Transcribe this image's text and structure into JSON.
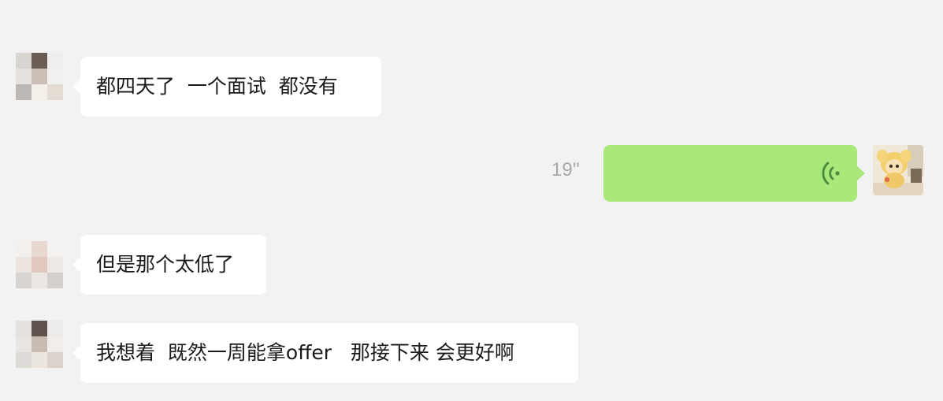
{
  "messages": [
    {
      "id": "m1",
      "sender": "contact",
      "type": "text",
      "text": "都四天了  一个面试  都没有"
    },
    {
      "id": "m2",
      "sender": "me",
      "type": "voice",
      "duration": "19''"
    },
    {
      "id": "m3",
      "sender": "contact",
      "type": "text",
      "text": "但是那个太低了"
    },
    {
      "id": "m4",
      "sender": "contact",
      "type": "text",
      "text": "我想着  既然一周能拿offer   那接下来 会更好啊"
    }
  ],
  "icons": {
    "contact_avatar": "blurred-avatar",
    "my_avatar": "cartoon-avatar",
    "voice": "voice-wave-icon"
  },
  "colors": {
    "background": "#f2f2f2",
    "incoming_bubble": "#ffffff",
    "outgoing_bubble": "#a9e97a",
    "voice_icon": "#4b8b3b",
    "duration_text": "#a8a8a8"
  }
}
